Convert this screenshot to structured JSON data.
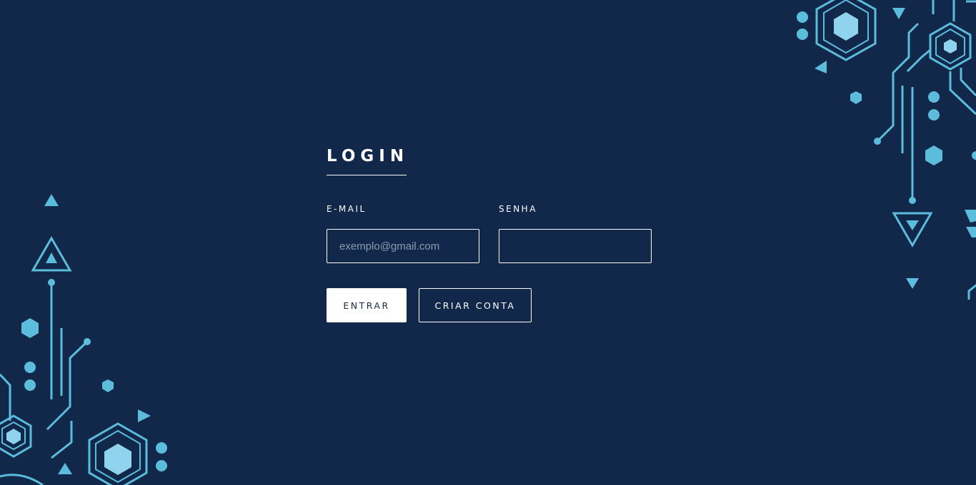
{
  "login": {
    "title": "LOGIN",
    "email_label": "E-MAIL",
    "email_placeholder": "exemplo@gmail.com",
    "email_value": "",
    "password_label": "SENHA",
    "password_value": "",
    "enter_button": "ENTRAR",
    "create_account_button": "CRIAR CONTA"
  },
  "colors": {
    "background": "#12284a",
    "accent": "#5bbcdb",
    "accent_fill": "#8fd3ee",
    "text": "#ffffff"
  },
  "decorations": {
    "top_right": "circuit-hexagon-pattern",
    "bottom_left": "circuit-hexagon-pattern"
  }
}
